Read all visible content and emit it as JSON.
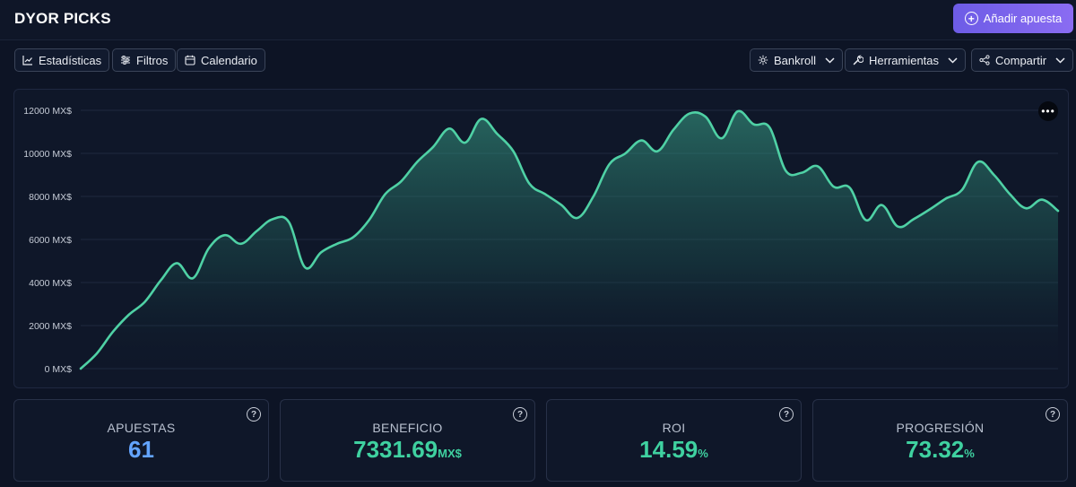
{
  "header": {
    "title": "DYOR PICKS",
    "add_bet_label": "Añadir apuesta"
  },
  "toolbar": {
    "left": [
      {
        "label": "Estadísticas",
        "icon": "line-chart-icon"
      },
      {
        "label": "Filtros",
        "icon": "sliders-icon"
      },
      {
        "label": "Calendario",
        "icon": "calendar-icon"
      }
    ],
    "right": [
      {
        "label": "Bankroll",
        "icon": "gear-icon"
      },
      {
        "label": "Herramientas",
        "icon": "wrench-icon"
      },
      {
        "label": "Compartir",
        "icon": "share-icon"
      }
    ]
  },
  "chart_data": {
    "type": "area",
    "title": "",
    "xlabel": "",
    "ylabel": "",
    "ylim": [
      0,
      12000
    ],
    "y_ticks": [
      "12000 MX$",
      "10000 MX$",
      "8000 MX$",
      "6000 MX$",
      "4000 MX$",
      "2000 MX$",
      "0 MX$"
    ],
    "y_tick_values": [
      12000,
      10000,
      8000,
      6000,
      4000,
      2000,
      0
    ],
    "grid": true,
    "series": [
      {
        "color": "#4fd1a5",
        "values": [
          0,
          700,
          1700,
          2500,
          3100,
          4100,
          4900,
          4200,
          5600,
          6200,
          5800,
          6400,
          6950,
          6800,
          4700,
          5400,
          5800,
          6100,
          6900,
          8100,
          8700,
          9600,
          10300,
          11150,
          10500,
          11600,
          10900,
          10100,
          8600,
          8100,
          7600,
          7000,
          8000,
          9500,
          10000,
          10600,
          10100,
          11100,
          11850,
          11700,
          10700,
          11950,
          11350,
          11200,
          9200,
          9100,
          9400,
          8450,
          8400,
          6900,
          7600,
          6600,
          6950,
          7400,
          7900,
          8300,
          9600,
          9000,
          8100,
          7450,
          7850,
          7330
        ]
      }
    ]
  },
  "stats": [
    {
      "label": "APUESTAS",
      "value": "61",
      "unit": "",
      "color": "#63a4ff"
    },
    {
      "label": "BENEFICIO",
      "value": "7331.69",
      "unit": "MX$",
      "color": "#3fd1a0"
    },
    {
      "label": "ROI",
      "value": "14.59",
      "unit": "%",
      "color": "#3fd1a0"
    },
    {
      "label": "PROGRESIÓN",
      "value": "73.32",
      "unit": "%",
      "color": "#3fd1a0"
    }
  ],
  "help_glyph": "?",
  "more_glyph": "•••",
  "colors": {
    "background": "#0d1425",
    "accent": "#7b63ee",
    "series": "#4fd1a5",
    "count_blue": "#63a4ff",
    "green": "#3fd1a0"
  }
}
